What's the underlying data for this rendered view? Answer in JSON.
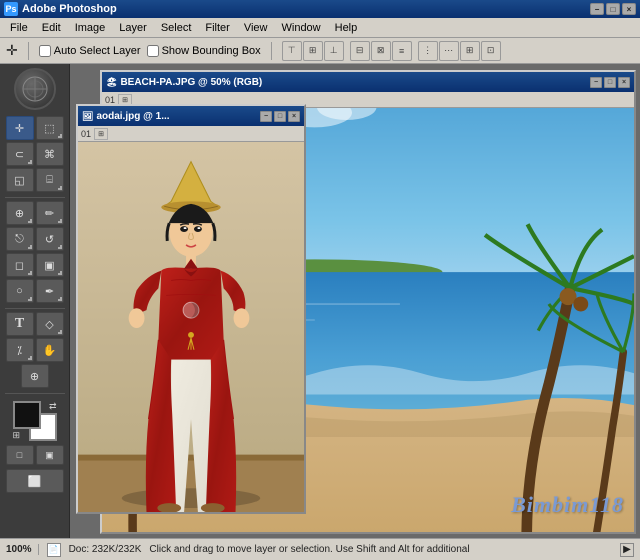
{
  "app": {
    "title": "Adobe Photoshop",
    "icon_label": "PS"
  },
  "title_bar": {
    "title": "Adobe Photoshop",
    "minimize": "−",
    "maximize": "□",
    "close": "×"
  },
  "menu_bar": {
    "items": [
      "File",
      "Edit",
      "Image",
      "Layer",
      "Select",
      "Filter",
      "View",
      "Window",
      "Help"
    ]
  },
  "options_bar": {
    "move_tool": "✛",
    "auto_select_label": "Auto Select Layer",
    "bounding_box_label": "Show Bounding Box"
  },
  "beach_window": {
    "title": "BEACH-PA.JPG @ 50% (RGB)",
    "channel_label": "01",
    "minimize": "−",
    "maximize": "□",
    "close": "×"
  },
  "aodai_window": {
    "title": "aodai.jpg @ 1...",
    "channel_label": "01",
    "minimize": "−",
    "maximize": "□",
    "close": "×"
  },
  "watermark": {
    "text": "Bimbim118"
  },
  "status_bar": {
    "zoom": "100%",
    "doc_info": "Doc: 232K/232K",
    "hint": "Click and drag to move layer or selection. Use Shift and Alt for additional",
    "arrow": "▶"
  },
  "toolbox": {
    "tools": [
      {
        "name": "move",
        "icon": "✛",
        "active": true
      },
      {
        "name": "marquee",
        "icon": "⬚"
      },
      {
        "name": "lasso",
        "icon": "⊂"
      },
      {
        "name": "magic-wand",
        "icon": "⌘"
      },
      {
        "name": "crop",
        "icon": "◱"
      },
      {
        "name": "slice",
        "icon": "⌸"
      },
      {
        "name": "heal",
        "icon": "⊕"
      },
      {
        "name": "brush",
        "icon": "✏"
      },
      {
        "name": "stamp",
        "icon": "⎋"
      },
      {
        "name": "history",
        "icon": "↺"
      },
      {
        "name": "eraser",
        "icon": "◻"
      },
      {
        "name": "gradient",
        "icon": "▣"
      },
      {
        "name": "dodge",
        "icon": "○"
      },
      {
        "name": "path",
        "icon": "✒"
      },
      {
        "name": "text",
        "icon": "T"
      },
      {
        "name": "shape",
        "icon": "◇"
      },
      {
        "name": "eyedropper",
        "icon": "⁒"
      },
      {
        "name": "hand",
        "icon": "✋"
      },
      {
        "name": "zoom",
        "icon": "⊕"
      }
    ]
  }
}
